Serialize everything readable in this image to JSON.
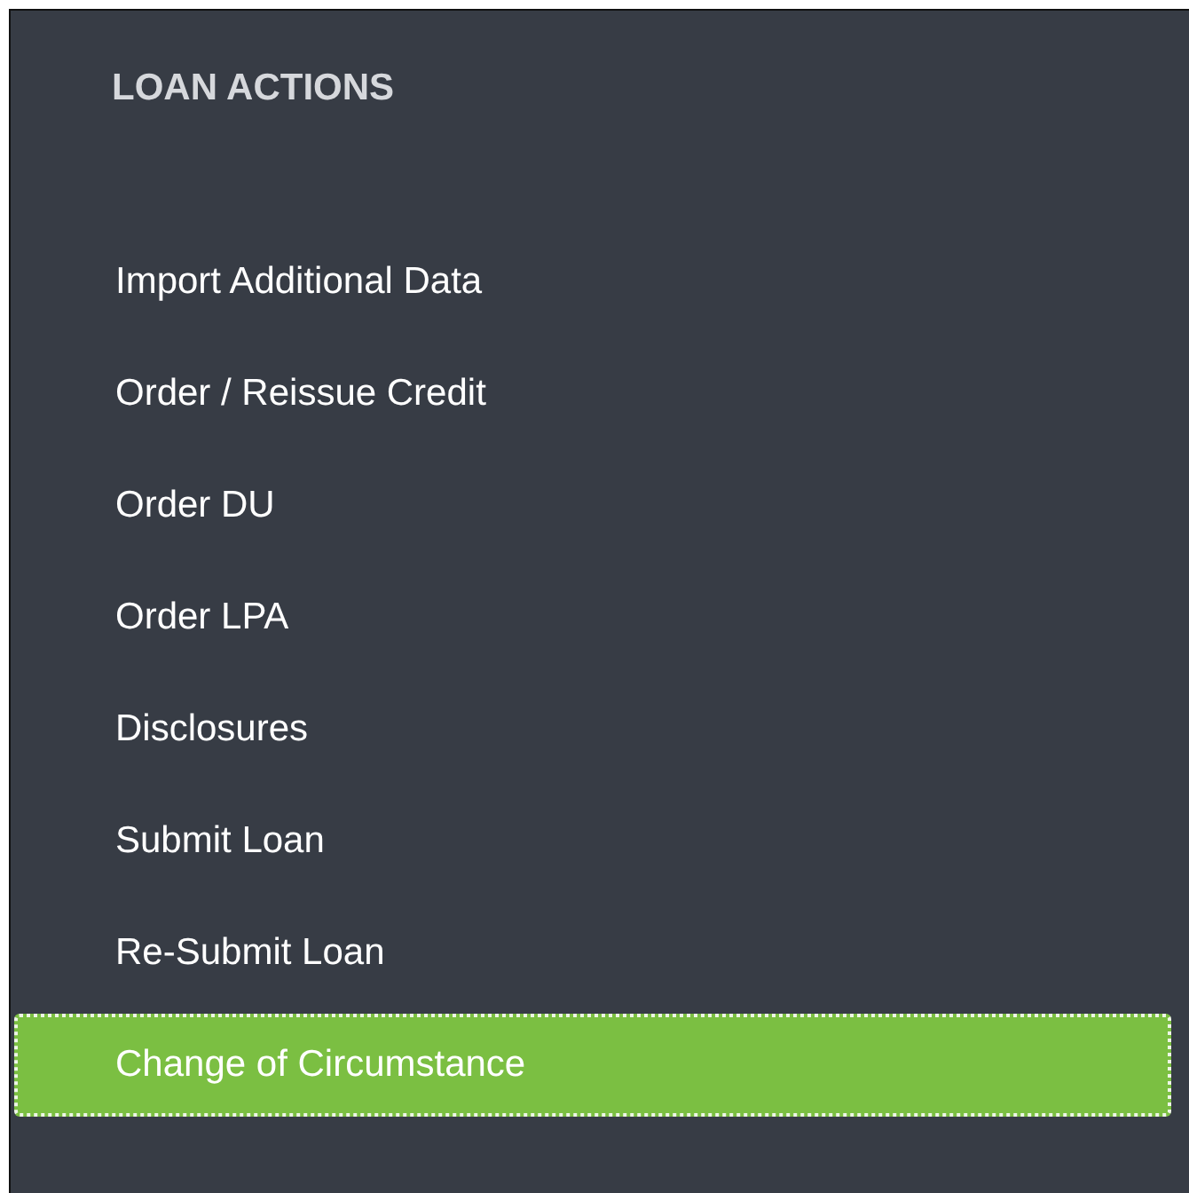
{
  "panel": {
    "title": "LOAN ACTIONS"
  },
  "actions": [
    {
      "label": "Import Additional Data",
      "selected": false
    },
    {
      "label": "Order / Reissue Credit",
      "selected": false
    },
    {
      "label": "Order DU",
      "selected": false
    },
    {
      "label": "Order LPA",
      "selected": false
    },
    {
      "label": "Disclosures",
      "selected": false
    },
    {
      "label": "Submit Loan",
      "selected": false
    },
    {
      "label": "Re-Submit Loan",
      "selected": false
    },
    {
      "label": "Change of Circumstance",
      "selected": true
    }
  ]
}
